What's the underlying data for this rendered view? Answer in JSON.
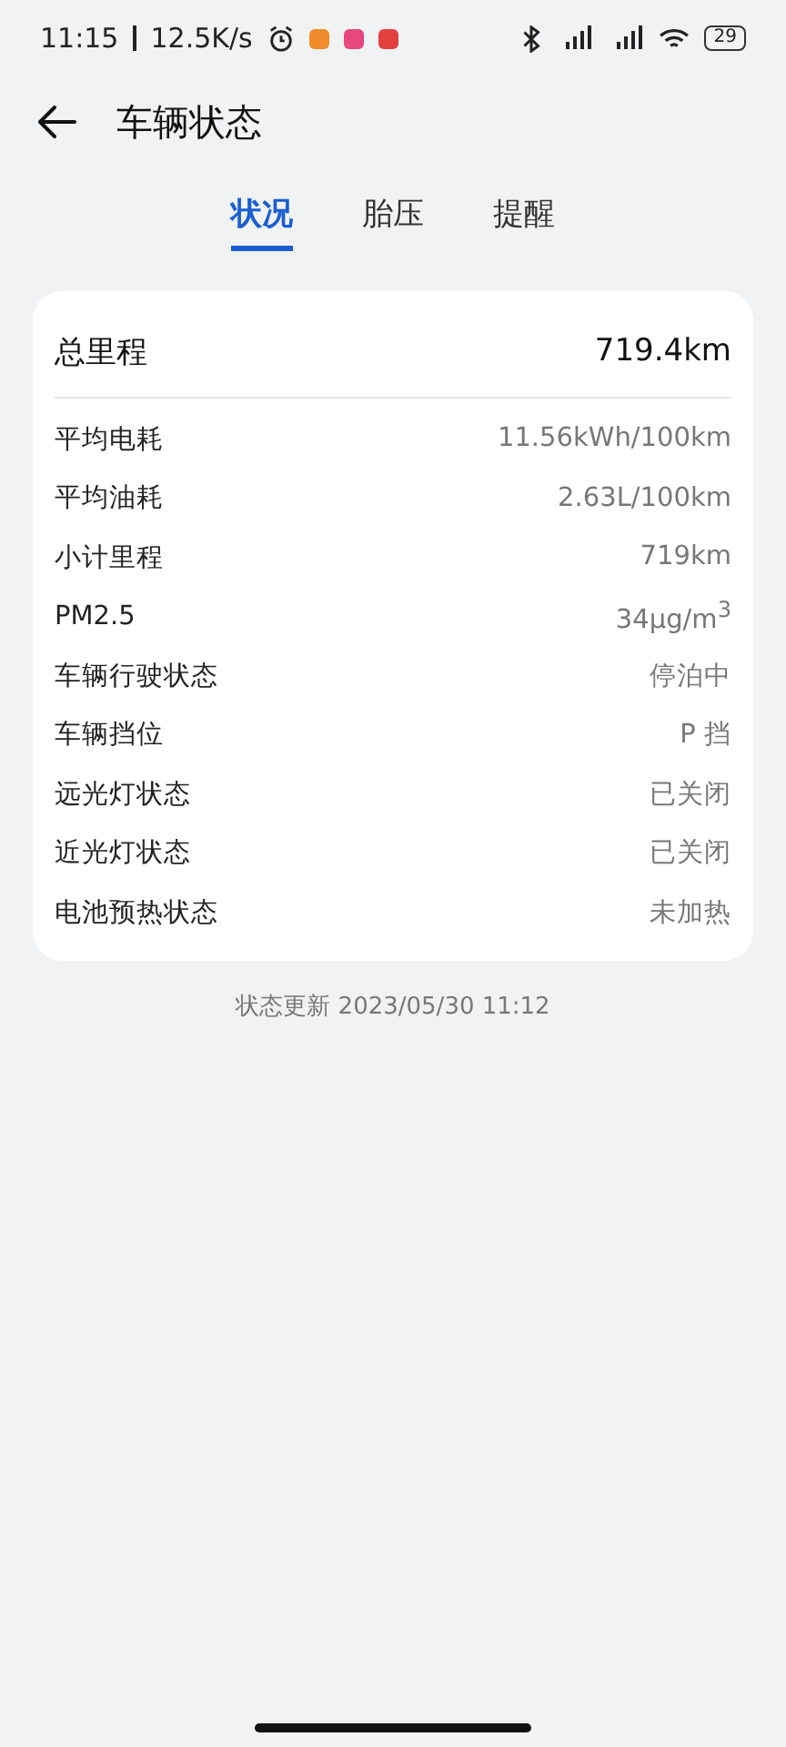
{
  "status_bar": {
    "time": "11:15",
    "speed": "12.5K/s",
    "battery": "29"
  },
  "header": {
    "title": "车辆状态"
  },
  "tabs": [
    {
      "label": "状况",
      "selected": true
    },
    {
      "label": "胎压",
      "selected": false
    },
    {
      "label": "提醒",
      "selected": false
    }
  ],
  "summary": {
    "label": "总里程",
    "value": "719.4km"
  },
  "rows": [
    {
      "label": "平均电耗",
      "value": "11.56kWh/100km"
    },
    {
      "label": "平均油耗",
      "value": "2.63L/100km"
    },
    {
      "label": "小计里程",
      "value": "719km"
    },
    {
      "label": "PM2.5",
      "value": "34μg/m$^{3}$"
    },
    {
      "label": "车辆行驶状态",
      "value": "停泊中"
    },
    {
      "label": "车辆挡位",
      "value": "P 挡"
    },
    {
      "label": "远光灯状态",
      "value": "已关闭"
    },
    {
      "label": "近光灯状态",
      "value": "已关闭"
    },
    {
      "label": "电池预热状态",
      "value": "未加热"
    }
  ],
  "footer": {
    "updated": "状态更新 2023/05/30 11:12"
  }
}
